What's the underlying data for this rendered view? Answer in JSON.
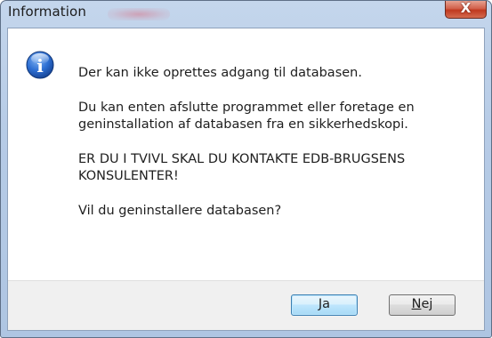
{
  "window": {
    "title": "Information",
    "close_glyph": "X"
  },
  "dialog": {
    "icon": "information-icon",
    "icon_glyph": "i",
    "messages": [
      "Der kan ikke oprettes adgang til databasen.",
      "Du kan enten afslutte programmet eller foretage en geninstallation af databasen fra en sikkerhedskopi.",
      "ER DU I TVIVL SKAL DU KONTAKTE EDB-BRUGSENS KONSULENTER!",
      "Vil du geninstallere databasen?"
    ]
  },
  "buttons": {
    "yes_label": "Ja",
    "no_label_underlined": "N",
    "no_label_rest": "ej"
  },
  "colors": {
    "frame": "#b6cbe6",
    "close_button": "#c0391f",
    "icon_blue": "#1f5fbf",
    "footer": "#f0f0f0",
    "default_button_border": "#3c7fb1"
  }
}
